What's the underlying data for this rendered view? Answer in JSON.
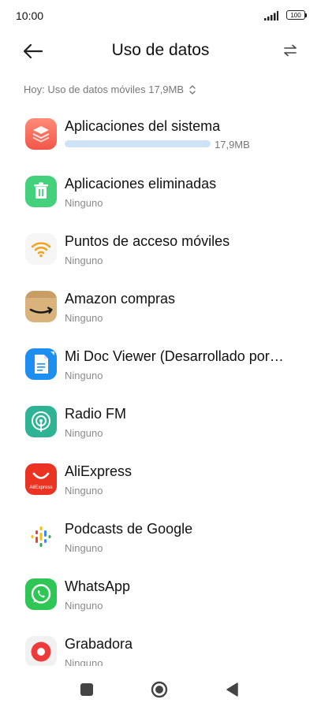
{
  "status_bar": {
    "time": "10:00",
    "battery": "100"
  },
  "header": {
    "title": "Uso de datos"
  },
  "subheader": {
    "label": "Hoy: Uso de datos móviles 17,9MB"
  },
  "apps": [
    {
      "name": "Aplicaciones del sistema",
      "usage": "17,9MB",
      "usage_fraction": 1.0,
      "icon": "system-apps-icon"
    },
    {
      "name": "Aplicaciones eliminadas",
      "sub": "Ninguno",
      "icon": "trash-icon"
    },
    {
      "name": "Puntos de acceso móviles",
      "sub": "Ninguno",
      "icon": "hotspot-icon"
    },
    {
      "name": "Amazon compras",
      "sub": "Ninguno",
      "icon": "amazon-icon"
    },
    {
      "name": "Mi Doc Viewer (Desarrollado por…",
      "sub": "Ninguno",
      "icon": "doc-viewer-icon"
    },
    {
      "name": "Radio FM",
      "sub": "Ninguno",
      "icon": "radio-icon"
    },
    {
      "name": "AliExpress",
      "sub": "Ninguno",
      "icon": "aliexpress-icon",
      "icon_text": "AliExpress"
    },
    {
      "name": "Podcasts de Google",
      "sub": "Ninguno",
      "icon": "podcasts-icon"
    },
    {
      "name": "WhatsApp",
      "sub": "Ninguno",
      "icon": "whatsapp-icon"
    },
    {
      "name": "Grabadora",
      "sub": "Ninguno",
      "icon": "recorder-icon"
    }
  ],
  "colors": {
    "usage_bar": "#cfe3f8",
    "secondary_text": "#8a8a8a"
  }
}
